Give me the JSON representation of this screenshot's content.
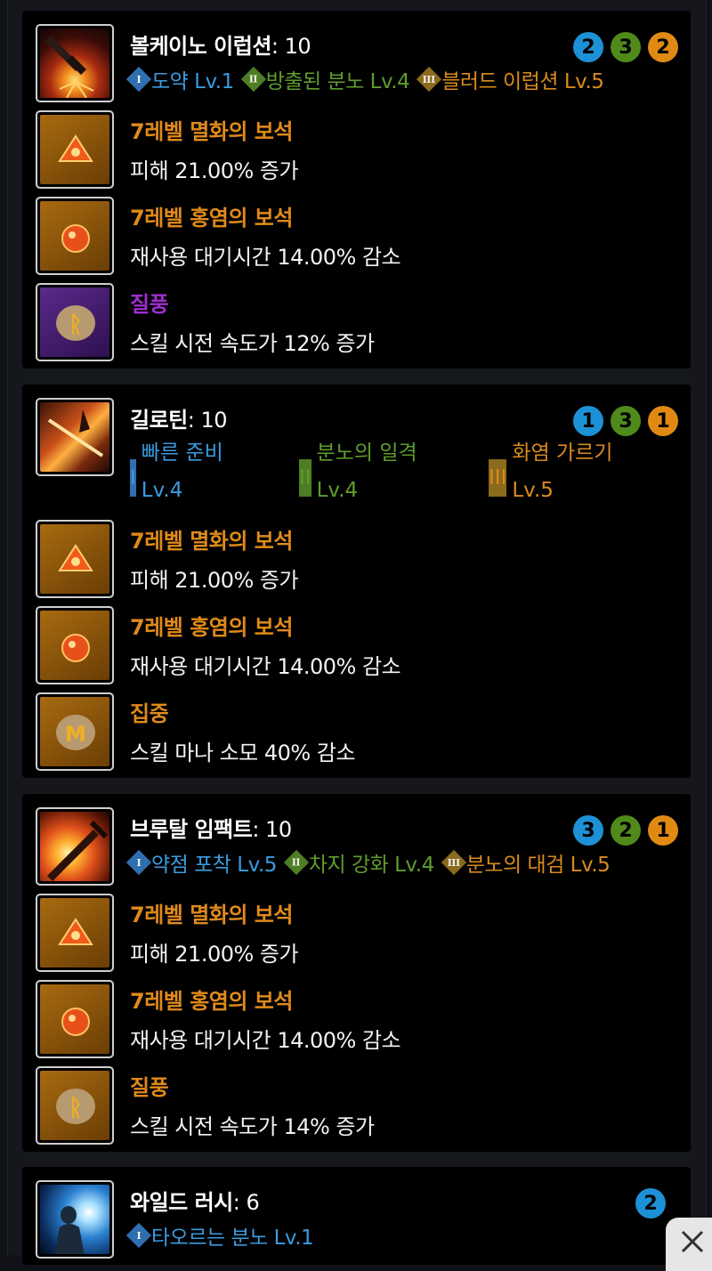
{
  "cards": [
    {
      "name": "볼케이노 이럽션",
      "level": ": 10",
      "badges": [
        "2",
        "3",
        "2"
      ],
      "tripods": [
        {
          "numeral": "I",
          "label": "도약 Lv.1"
        },
        {
          "numeral": "II",
          "label": "방출된 분노 Lv.4"
        },
        {
          "numeral": "III",
          "label": "블러드 이럽션 Lv.5"
        }
      ],
      "gems": [
        {
          "title": "7레벨 멸화의 보석",
          "desc": "피해 21.00% 증가"
        },
        {
          "title": "7레벨 홍염의 보석",
          "desc": "재사용 대기시간 14.00% 감소"
        },
        {
          "title": "질풍",
          "desc": "스킬 시전 속도가 12% 증가",
          "rune_glyph": "ᚱ"
        }
      ]
    },
    {
      "name": "길로틴",
      "level": ": 10",
      "badges": [
        "1",
        "3",
        "1"
      ],
      "tripods": [
        {
          "numeral": "I",
          "name": "빠른 준비",
          "lv": "Lv.4"
        },
        {
          "numeral": "II",
          "name": "분노의 일격",
          "lv": "Lv.4"
        },
        {
          "numeral": "III",
          "name": "화염 가르기",
          "lv": "Lv.5"
        }
      ],
      "gems": [
        {
          "title": "7레벨 멸화의 보석",
          "desc": "피해 21.00% 증가"
        },
        {
          "title": "7레벨 홍염의 보석",
          "desc": "재사용 대기시간 14.00% 감소"
        },
        {
          "title": "집중",
          "desc": "스킬 마나 소모 40% 감소",
          "rune_glyph": "M"
        }
      ]
    },
    {
      "name": "브루탈 임팩트",
      "level": ": 10",
      "badges": [
        "3",
        "2",
        "1"
      ],
      "tripods": [
        {
          "numeral": "I",
          "label": "약점 포착 Lv.5"
        },
        {
          "numeral": "II",
          "label": "차지 강화 Lv.4"
        },
        {
          "numeral": "III",
          "label": "분노의 대검 Lv.5"
        }
      ],
      "gems": [
        {
          "title": "7레벨 멸화의 보석",
          "desc": "피해 21.00% 증가"
        },
        {
          "title": "7레벨 홍염의 보석",
          "desc": "재사용 대기시간 14.00% 감소"
        },
        {
          "title": "질풍",
          "desc": "스킬 시전 속도가 14% 증가",
          "rune_glyph": "ᚱ"
        }
      ]
    },
    {
      "name": "와일드 러시",
      "level": ": 6",
      "badges": [
        "2"
      ],
      "tripods": [
        {
          "numeral": "I",
          "label": "타오르는 분노 Lv.1"
        }
      ]
    }
  ],
  "colors": {
    "tier1": "#3a9be0",
    "tier2": "#5f9d2e",
    "tier3": "#d98b1e",
    "gem_title": "#e08a1a",
    "rune_epic": "#a12ed0"
  },
  "icons": {
    "close": "close-icon"
  }
}
